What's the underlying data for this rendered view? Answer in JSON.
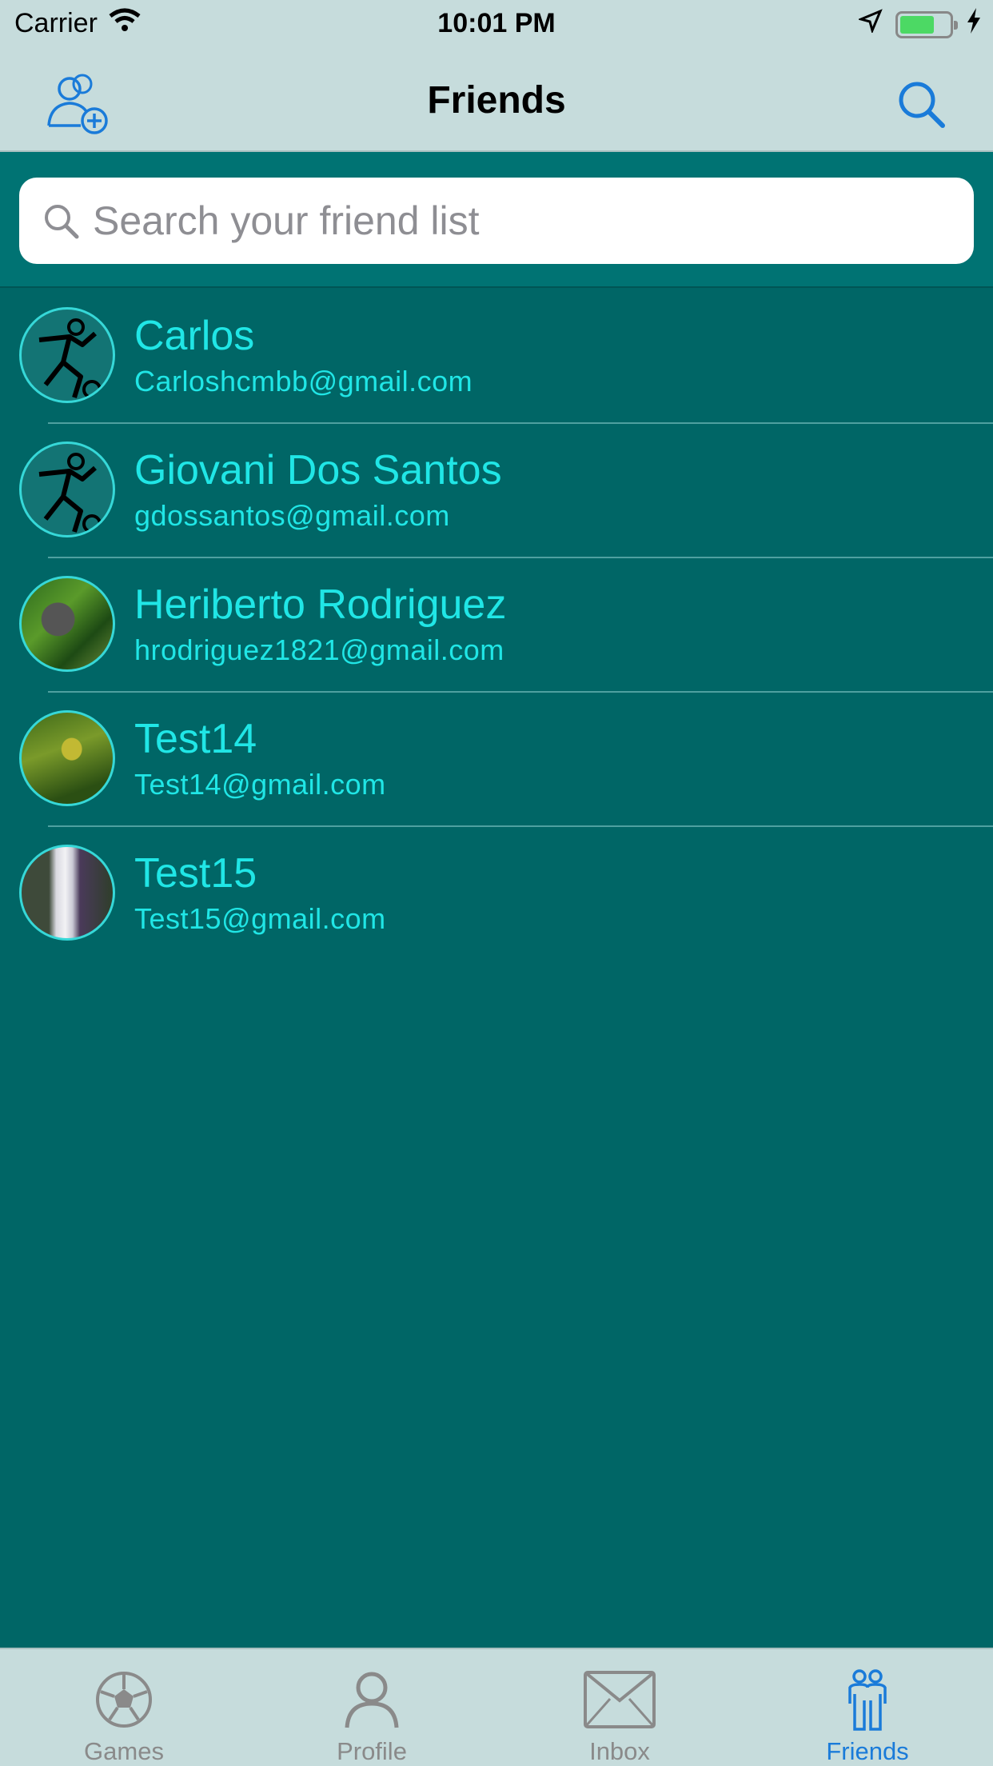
{
  "status_bar": {
    "carrier": "Carrier",
    "time": "10:01 PM"
  },
  "nav": {
    "title": "Friends",
    "add_friend_icon": "add-user-icon",
    "search_icon": "search-icon"
  },
  "search": {
    "placeholder": "Search your friend list"
  },
  "friends": [
    {
      "name": "Carlos",
      "email": "Carloshcmbb@gmail.com",
      "avatar": "soccer-player-icon"
    },
    {
      "name": "Giovani Dos Santos",
      "email": "gdossantos@gmail.com",
      "avatar": "soccer-player-icon"
    },
    {
      "name": "Heriberto Rodriguez",
      "email": "hrodriguez1821@gmail.com",
      "avatar": "photo-gorilla"
    },
    {
      "name": "Test14",
      "email": "Test14@gmail.com",
      "avatar": "photo-plant"
    },
    {
      "name": "Test15",
      "email": "Test15@gmail.com",
      "avatar": "photo-waterfall"
    }
  ],
  "tabs": [
    {
      "label": "Games",
      "icon": "soccer-ball-icon",
      "active": false
    },
    {
      "label": "Profile",
      "icon": "person-icon",
      "active": false
    },
    {
      "label": "Inbox",
      "icon": "mail-icon",
      "active": false
    },
    {
      "label": "Friends",
      "icon": "friends-icon",
      "active": true
    }
  ],
  "colors": {
    "background": "#006666",
    "bar": "#c6dcdc",
    "accent_text": "#20e6e6",
    "active_tab": "#1a7bd9"
  }
}
